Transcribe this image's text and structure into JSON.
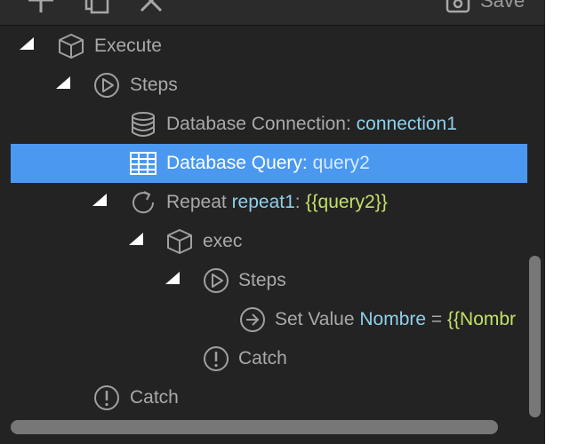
{
  "toolbar": {
    "save_label": "Save",
    "icons": [
      "add-icon",
      "copy-icon",
      "close-icon",
      "save-icon"
    ]
  },
  "tree": {
    "execute": "Execute",
    "steps": "Steps",
    "db_connection": {
      "type": "Database Connection:",
      "name": "connection1"
    },
    "db_query": {
      "type": "Database Query:",
      "name": "query2"
    },
    "repeat": {
      "type": "Repeat",
      "name": "repeat1",
      "sep": ":",
      "expr": "{{query2}}"
    },
    "exec": "exec",
    "inner_steps": "Steps",
    "set_value": {
      "type": "Set Value",
      "name": "Nombre",
      "op": "=",
      "expr": "{{Nombr"
    },
    "inner_catch": "Catch",
    "catch": "Catch"
  },
  "colors": {
    "panel_bg": "#232323",
    "selected_bg": "#4b98f0",
    "name_blue": "#8fd0ea",
    "expr_green": "#c3e166",
    "text_gray": "#a9a9a9"
  }
}
